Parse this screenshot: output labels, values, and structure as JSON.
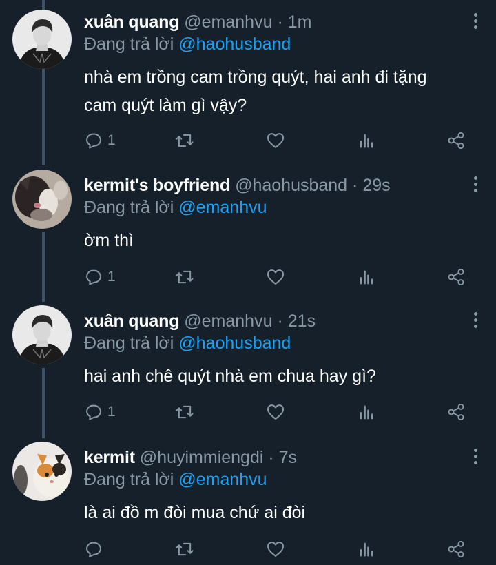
{
  "reply_prefix": "Đang trả lời",
  "tweets": [
    {
      "display_name": "xuân quang",
      "handle": "@emanhvu",
      "separator": "·",
      "time": "1m",
      "reply_to": "@haohusband",
      "text_lines": [
        "nhà em trồng cam trồng quýt, hai anh đi tặng",
        "cam quýt làm gì vậy?"
      ],
      "reply_count": "1",
      "avatar": "person-portrait"
    },
    {
      "display_name": "kermit's boyfriend",
      "handle": "@haohusband",
      "separator": "·",
      "time": "29s",
      "reply_to": "@emanhvu",
      "text_lines": [
        "ờm thì"
      ],
      "reply_count": "1",
      "avatar": "blurry-cat"
    },
    {
      "display_name": "xuân quang",
      "handle": "@emanhvu",
      "separator": "·",
      "time": "21s",
      "reply_to": "@haohusband",
      "text_lines": [
        "hai anh chê quýt nhà em chua hay gì?"
      ],
      "reply_count": "1",
      "avatar": "person-portrait"
    },
    {
      "display_name": "kermit",
      "handle": "@huyimmiengdi",
      "separator": "·",
      "time": "7s",
      "reply_to": "@emanhvu",
      "text_lines": [
        "là ai đồ m đòi mua chứ ai đòi"
      ],
      "reply_count": "",
      "avatar": "calico-cat"
    }
  ],
  "icons": [
    "reply-icon",
    "retweet-icon",
    "like-icon",
    "analytics-icon",
    "share-icon",
    "more-options-icon"
  ],
  "colors": {
    "background": "#15202b",
    "text": "#ffffff",
    "muted": "#8899a6",
    "link": "#1da1f2",
    "thread_line": "#3d5466"
  }
}
